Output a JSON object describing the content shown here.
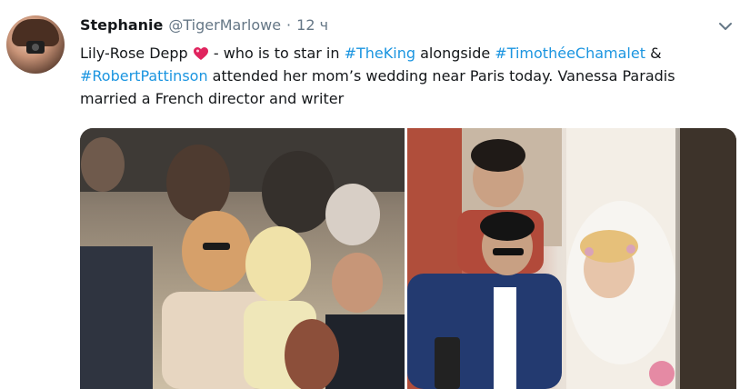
{
  "tweet": {
    "author_name": "Stephanie",
    "author_handle": "@TigerMarlowe",
    "separator": "·",
    "time": "12 ч",
    "text_parts": [
      {
        "text": "Lily-Rose Depp "
      },
      {
        "emoji": "sparkling-heart-icon"
      },
      {
        "text": " - who is to star in "
      },
      {
        "hashtag": "#TheKing"
      },
      {
        "text": " alongside "
      },
      {
        "hashtag": "#TimothéeChamalet"
      },
      {
        "text": " & "
      },
      {
        "hashtag": "#RobertPattinson"
      },
      {
        "text": " attended her mom’s wedding near Paris today. Vanessa Paradis married a French director and writer"
      }
    ]
  },
  "colors": {
    "hashtag": "#1b95e0",
    "secondary_text": "#657786",
    "primary_text": "#14171a",
    "heart": "#e0245e"
  },
  "icons": {
    "menu": "chevron-down-icon",
    "emoji": "sparkling-heart-icon"
  }
}
